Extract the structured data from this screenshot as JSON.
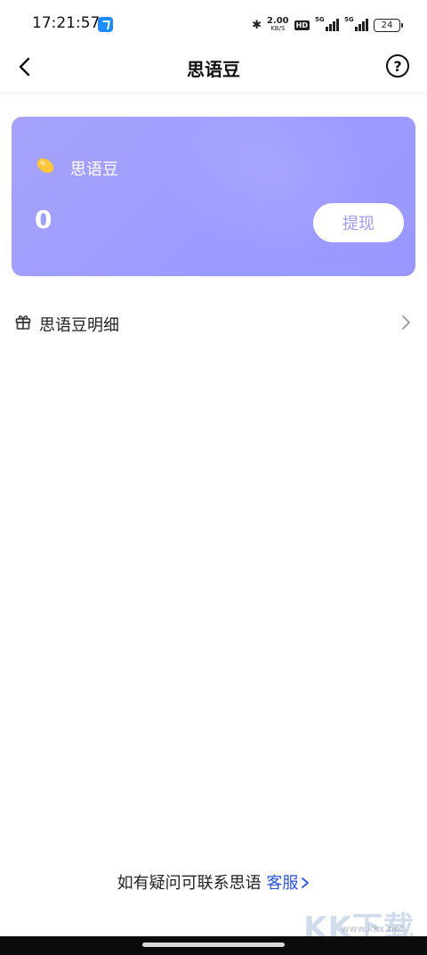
{
  "status_bar": {
    "time": "17:21:57",
    "speed_value": "2.00",
    "speed_unit": "KB/S",
    "hd": "HD",
    "network_1": "5G",
    "network_2": "5G",
    "battery": "24"
  },
  "nav": {
    "title": "思语豆",
    "help_symbol": "?"
  },
  "card": {
    "label": "思语豆",
    "balance": "0",
    "withdraw_label": "提现"
  },
  "detail": {
    "label": "思语豆明细"
  },
  "footer": {
    "prompt": "如有疑问可联系思语",
    "link": "客服"
  },
  "watermark": {
    "text": "KK下载",
    "url": "www.kkx.net"
  },
  "colors": {
    "card": "#9d9bff",
    "withdraw_text": "#9d9bf3",
    "link": "#2b56d8"
  }
}
